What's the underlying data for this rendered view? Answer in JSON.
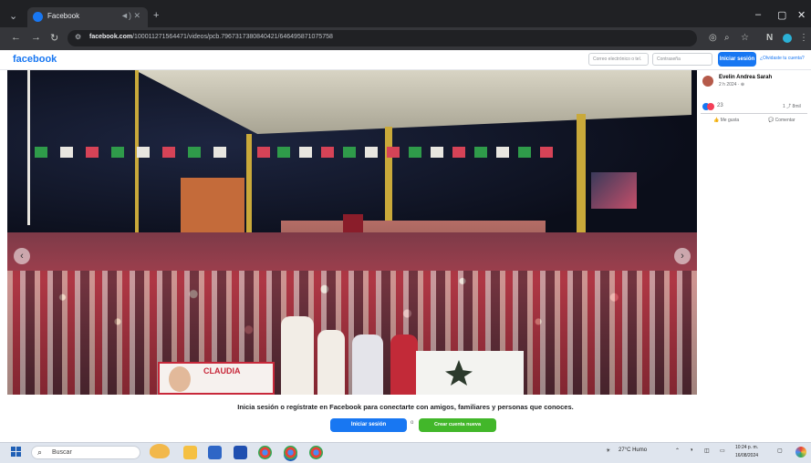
{
  "browser": {
    "tab_title": "Facebook",
    "tab_controls": "◄) ✕",
    "new_tab": "+",
    "url_domain": "facebook.com",
    "url_path": "/100011271564471/videos/pcb.7967317380840421/646495871075758",
    "window_controls": [
      "–",
      "▢",
      "✕"
    ]
  },
  "facebook": {
    "logo": "facebook",
    "email_placeholder": "Correo electrónico o tel.",
    "password_placeholder": "Contraseña",
    "login_label": "Iniciar sesión",
    "forgot_label": "¿Olvidaste tu cuenta?"
  },
  "post": {
    "author": "Evelin Andrea Sarah",
    "meta": "2 h 2024 · ⊕",
    "reactions_count": "23",
    "shares": "1 ⤴ 8mil",
    "like_label": "Me gusta",
    "comment_label": "Comentar",
    "banner_text": "CLAUDIA"
  },
  "prompt": {
    "text": "Inicia sesión o regístrate en Facebook para conectarte con amigos, familiares y personas que conoces.",
    "login_label": "Iniciar sesión",
    "or_label": "o",
    "create_label": "Crear cuenta nueva"
  },
  "taskbar": {
    "search_label": "Buscar",
    "weather": "27°C Humo",
    "time": "10:24 p. m.",
    "date": "16/08/2024"
  },
  "colors": {
    "fb_blue": "#1877f2",
    "fb_green": "#42b72a",
    "browser_dark": "#202124"
  }
}
